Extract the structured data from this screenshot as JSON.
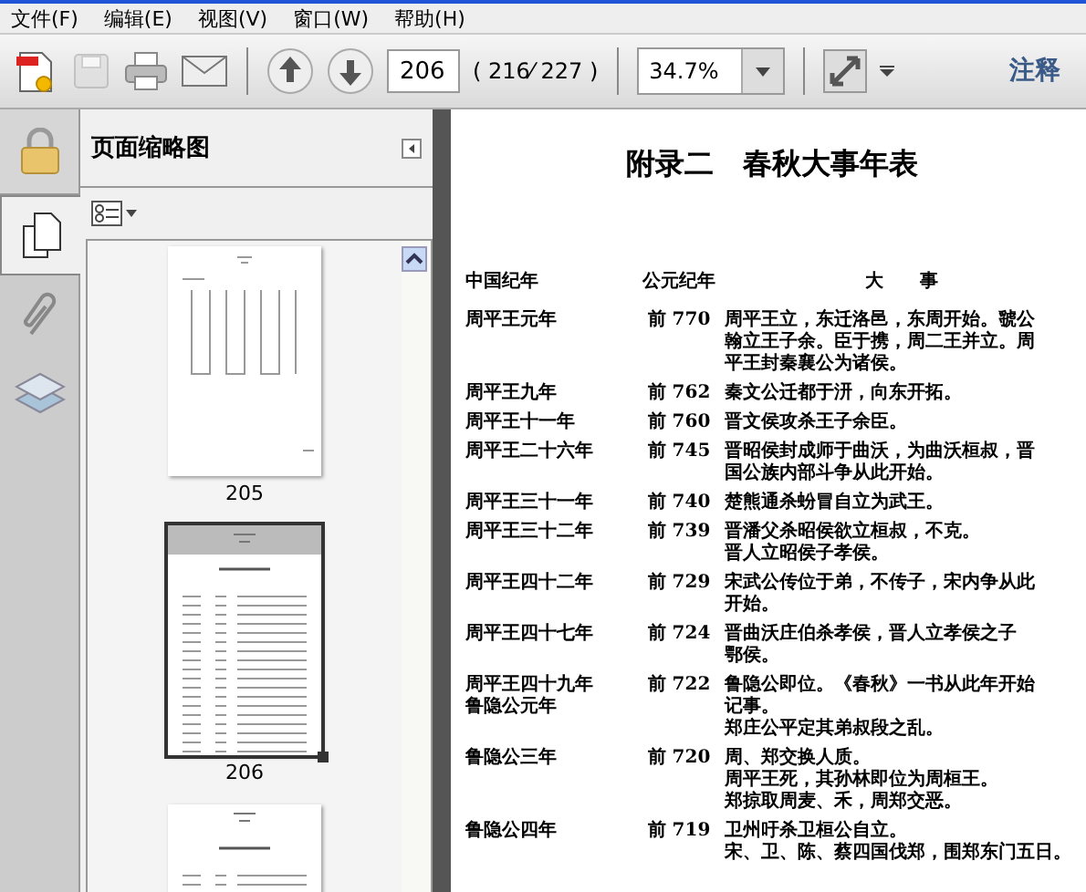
{
  "menu": [
    "文件(F)",
    "编辑(E)",
    "视图(V)",
    "窗口(W)",
    "帮助(H)"
  ],
  "toolbar": {
    "page_input": "206",
    "page_count": "( 216⁄ 227 )",
    "zoom": "34.7%",
    "comment_label": "注释",
    "save_disabled": true
  },
  "sidebar_tabs": [
    {
      "kind": "lock",
      "selected": false
    },
    {
      "kind": "pages",
      "selected": true
    },
    {
      "kind": "attachments",
      "selected": false
    },
    {
      "kind": "layers",
      "selected": false
    }
  ],
  "sidebar": {
    "title": "页面缩略图",
    "thumbnails": [
      {
        "label": "205",
        "selected": false,
        "kind": "grid"
      },
      {
        "label": "206",
        "selected": true,
        "kind": "table"
      },
      {
        "selected": false,
        "kind": "table"
      }
    ]
  },
  "document": {
    "title": "附录二　春秋大事年表",
    "columns": [
      "中国纪年",
      "公元纪年",
      "大　　事"
    ],
    "rows": [
      {
        "era": [
          "周平王元年"
        ],
        "year": "前 770",
        "events": [
          "周平王立，东迁洛邑，东周开始。虢公",
          "翰立王子余。臣于携，周二王并立。周",
          "平王封秦襄公为诸侯。"
        ]
      },
      {
        "era": [
          "周平王九年"
        ],
        "year": "前 762",
        "events": [
          "秦文公迁都于汧，向东开拓。"
        ]
      },
      {
        "era": [
          "周平王十一年"
        ],
        "year": "前 760",
        "events": [
          "晋文侯攻杀王子余臣。"
        ]
      },
      {
        "era": [
          "周平王二十六年"
        ],
        "year": "前 745",
        "events": [
          "晋昭侯封成师于曲沃，为曲沃桓叔，晋",
          "国公族内部斗争从此开始。"
        ]
      },
      {
        "era": [
          "周平王三十一年"
        ],
        "year": "前 740",
        "events": [
          "楚熊通杀蚡冒自立为武王。"
        ]
      },
      {
        "era": [
          "周平王三十二年"
        ],
        "year": "前 739",
        "events": [
          "晋潘父杀昭侯欲立桓叔，不克。",
          "晋人立昭侯子孝侯。"
        ]
      },
      {
        "era": [
          "周平王四十二年"
        ],
        "year": "前 729",
        "events": [
          "宋武公传位于弟，不传子，宋内争从此",
          "开始。"
        ]
      },
      {
        "era": [
          "周平王四十七年"
        ],
        "year": "前 724",
        "events": [
          "晋曲沃庄伯杀孝侯，晋人立孝侯之子",
          "鄂侯。"
        ]
      },
      {
        "era": [
          "周平王四十九年",
          "鲁隐公元年"
        ],
        "year": "前 722",
        "events": [
          "鲁隐公即位。《春秋》一书从此年开始",
          "记事。",
          "郑庄公平定其弟叔段之乱。"
        ]
      },
      {
        "era": [
          "鲁隐公三年"
        ],
        "year": "前 720",
        "events": [
          "周、郑交换人质。",
          "周平王死，其孙林即位为周桓王。",
          "郑掠取周麦、禾，周郑交恶。"
        ]
      },
      {
        "era": [
          "鲁隐公四年"
        ],
        "year": "前 719",
        "events": [
          "卫州吁杀卫桓公自立。",
          "宋、卫、陈、蔡四国伐郑，围郑东门五日。"
        ]
      }
    ]
  }
}
